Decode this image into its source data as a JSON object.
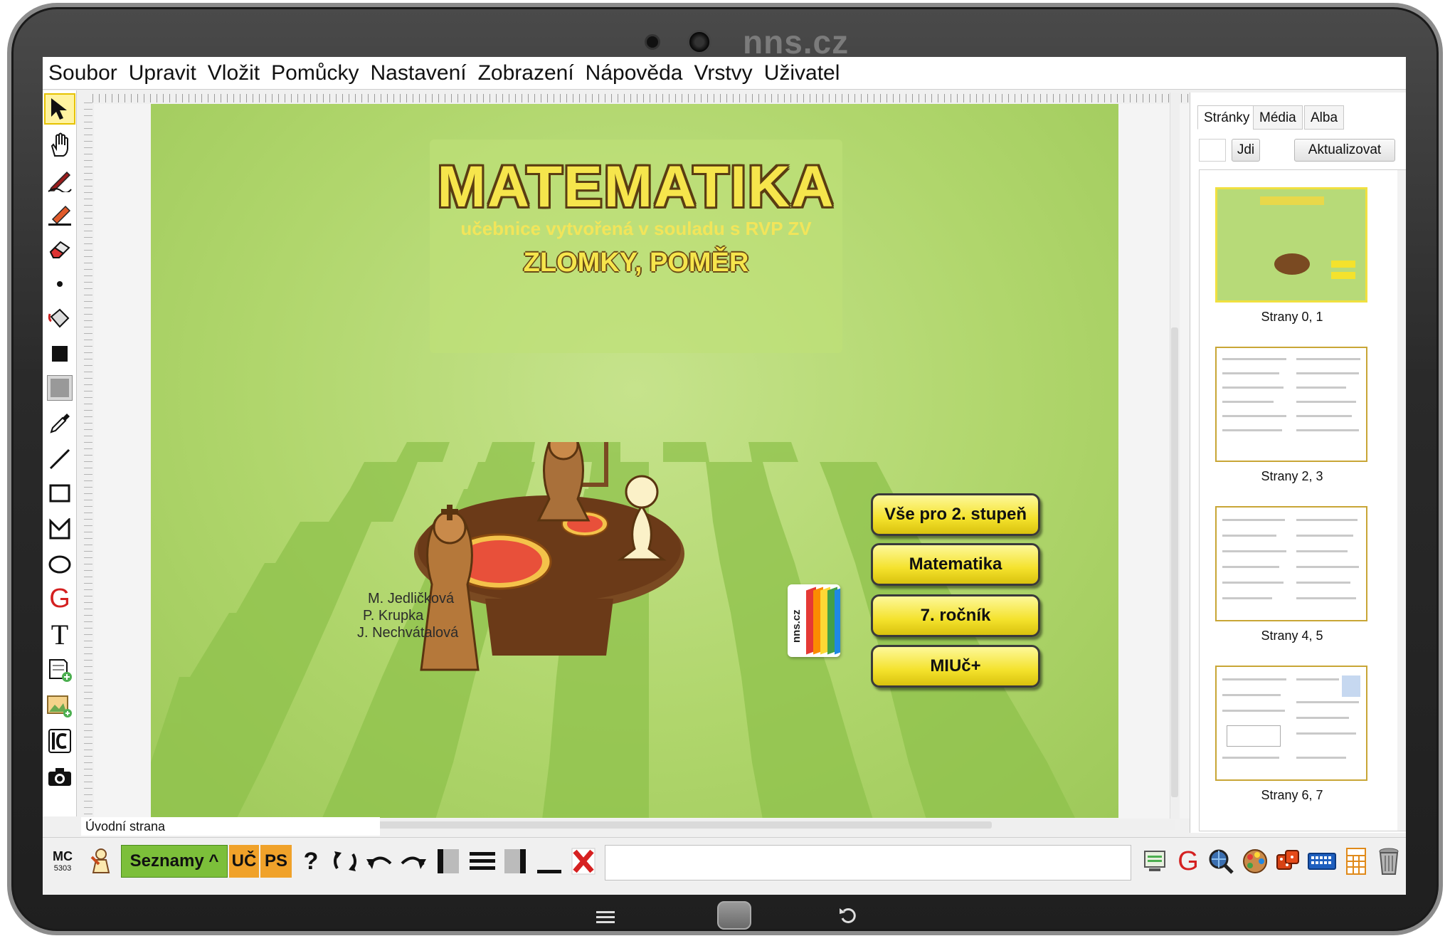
{
  "device": {
    "brand": "nns.cz"
  },
  "menu": [
    "Soubor",
    "Upravit",
    "Vložit",
    "Pomůcky",
    "Nastavení",
    "Zobrazení",
    "Nápověda",
    "Vrstvy",
    "Uživatel"
  ],
  "toolbar": {
    "tools": [
      "select-arrow-icon",
      "hand-pan-icon",
      "pen-icon",
      "highlighter-icon",
      "eraser-icon",
      "dot-icon",
      "fill-bucket-icon",
      "black-square-icon",
      "gray-square-icon",
      "eyedropper-icon",
      "line-icon",
      "rectangle-icon",
      "polygon-icon",
      "ellipse-icon",
      "handwriting-g-icon",
      "text-t-icon",
      "add-note-icon",
      "add-image-icon",
      "ic-icon",
      "camera-icon"
    ],
    "handwriting_glyph": "G",
    "text_glyph": "T"
  },
  "page": {
    "title": "MATEMATIKA",
    "subtitle": "učebnice vytvořená v souladu s RVP ZV",
    "topic": "ZLOMKY, POMĚR",
    "authors": [
      "M. Jedličková",
      "P. Krupka",
      "J. Nechvátalová"
    ],
    "logo_text": "nns.cz",
    "buttons": [
      "Vše pro 2. stupeň",
      "Matematika",
      "7. ročník",
      "MIUč+"
    ],
    "name": "Úvodní strana"
  },
  "right_panel": {
    "tabs": [
      "Stránky",
      "Média",
      "Alba"
    ],
    "active_tab": "Stránky",
    "go_button": "Jdi",
    "refresh_button": "Aktualizovat",
    "thumbnails": [
      "Strany 0, 1",
      "Strany 2, 3",
      "Strany 4, 5",
      "Strany 6, 7"
    ]
  },
  "bottom_bar": {
    "mc_label": "MC",
    "mc_number": "5303",
    "seznamy_label": "Seznamy",
    "seznamy_arrow": "^",
    "uc_label": "UČ",
    "ps_label": "PS",
    "help_glyph": "?",
    "g_glyph": "G"
  },
  "colors": {
    "page_green": "#b0d66c",
    "title_yellow": "#f6e54c",
    "button_yellow": "#f4e22c",
    "seznamy_green": "#7cbf3a",
    "uc_orange": "#f0a22a"
  }
}
